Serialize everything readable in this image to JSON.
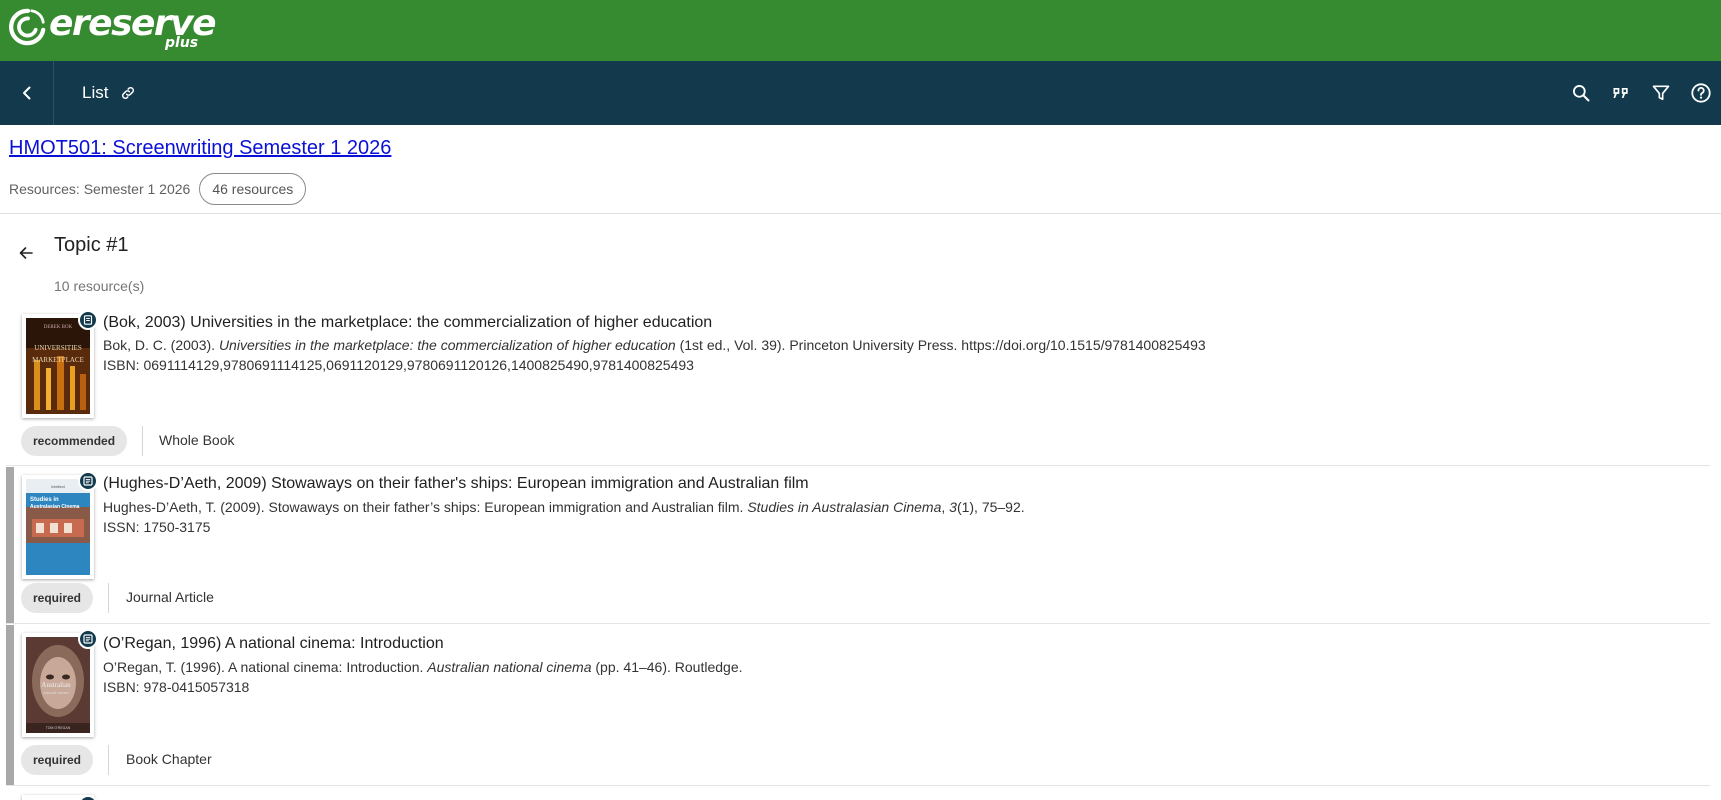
{
  "brand": {
    "logo_text": "ereserve",
    "logo_sub": "plus",
    "color": "#368a30"
  },
  "nav": {
    "bg": "#123a4c",
    "title": "List",
    "icons": [
      "chevron-left-icon",
      "link-icon",
      "search-icon",
      "quote-icon",
      "filter-icon",
      "help-icon"
    ]
  },
  "course": {
    "title": "HMOT501: Screenwriting Semester 1 2026",
    "resources_label": "Resources: Semester 1 2026",
    "resources_count": "46 resources"
  },
  "topic": {
    "title": "Topic #1",
    "count": "10 resource(s)"
  },
  "items": [
    {
      "title": "(Bok, 2003) Universities in the marketplace: the commercialization of higher education",
      "cite_pre": "Bok, D. C. (2003). ",
      "cite_italic": "Universities in the marketplace: the commercialization of higher education",
      "cite_post": " (1st ed., Vol. 39). Princeton University Press. https://doi.org/10.1515/9781400825493",
      "isbn": "ISBN: 0691114129,9780691114125,0691120129,9780691120126,1400825490,9781400825493",
      "tag": "recommended",
      "kind": "Whole Book",
      "badge_icon": "book-icon"
    },
    {
      "title": "(Hughes-D’Aeth, 2009) Stowaways on their father's ships: European immigration and Australian film",
      "cite_pre": "Hughes-D’Aeth, T. (2009). Stowaways on their father’s ships: European immigration and Australian film. ",
      "cite_italic": "Studies in Australasian Cinema",
      "cite_mid": ", ",
      "cite_italic2": "3",
      "cite_post": "(1), 75–92.",
      "isbn": "ISSN: 1750-3175",
      "tag": "required",
      "kind": "Journal Article",
      "badge_icon": "article-icon",
      "thumb_text": "Studies in Australasian Cinema"
    },
    {
      "title": "(O’Regan, 1996) A national cinema: Introduction",
      "cite_pre": "O’Regan, T. (1996). A national cinema: Introduction. ",
      "cite_italic": "Australian national cinema",
      "cite_post": " (pp. 41–46). Routledge.",
      "isbn": "ISBN: 978-0415057318",
      "tag": "required",
      "kind": "Book Chapter",
      "badge_icon": "article-icon"
    }
  ]
}
